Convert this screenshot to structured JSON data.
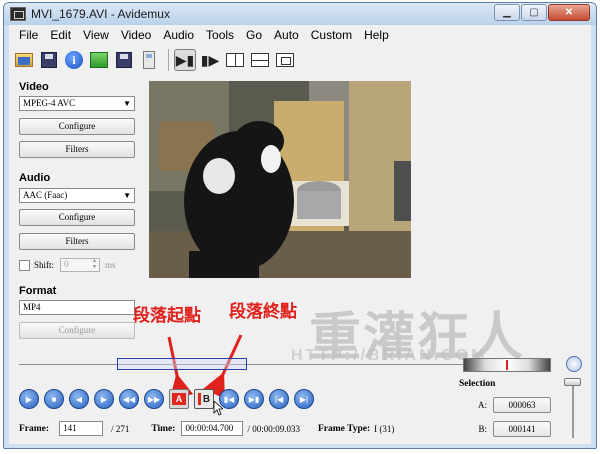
{
  "window": {
    "title": "MVI_1679.AVI - Avidemux"
  },
  "menu": [
    "File",
    "Edit",
    "View",
    "Video",
    "Audio",
    "Tools",
    "Go",
    "Auto",
    "Custom",
    "Help"
  ],
  "left_panel": {
    "video": {
      "label": "Video",
      "codec": "MPEG-4 AVC",
      "configure": "Configure",
      "filters": "Filters"
    },
    "audio": {
      "label": "Audio",
      "codec": "AAC (Faac)",
      "configure": "Configure",
      "filters": "Filters",
      "shift_label": "Shift:",
      "shift_value": "0",
      "shift_unit": "ms"
    },
    "format": {
      "label": "Format",
      "container": "MP4",
      "configure": "Configure"
    }
  },
  "annotations": {
    "start": "段落起點",
    "end": "段落終點"
  },
  "watermark": {
    "main": "重灌狂人",
    "sub": "HTTP://BRIAN.COM"
  },
  "transport": {
    "mark_a": "A",
    "mark_b": "B"
  },
  "status": {
    "frame_label": "Frame:",
    "frame_value": "141",
    "frame_total": "/ 271",
    "time_label": "Time:",
    "time_value": "00:00:04.700",
    "time_total": "/ 00:00:09.033",
    "frame_type_label": "Frame Type:",
    "frame_type_value": "I (31)"
  },
  "selection": {
    "title": "Selection",
    "a_label": "A:",
    "a_value": "000063",
    "b_label": "B:",
    "b_value": "000141"
  }
}
